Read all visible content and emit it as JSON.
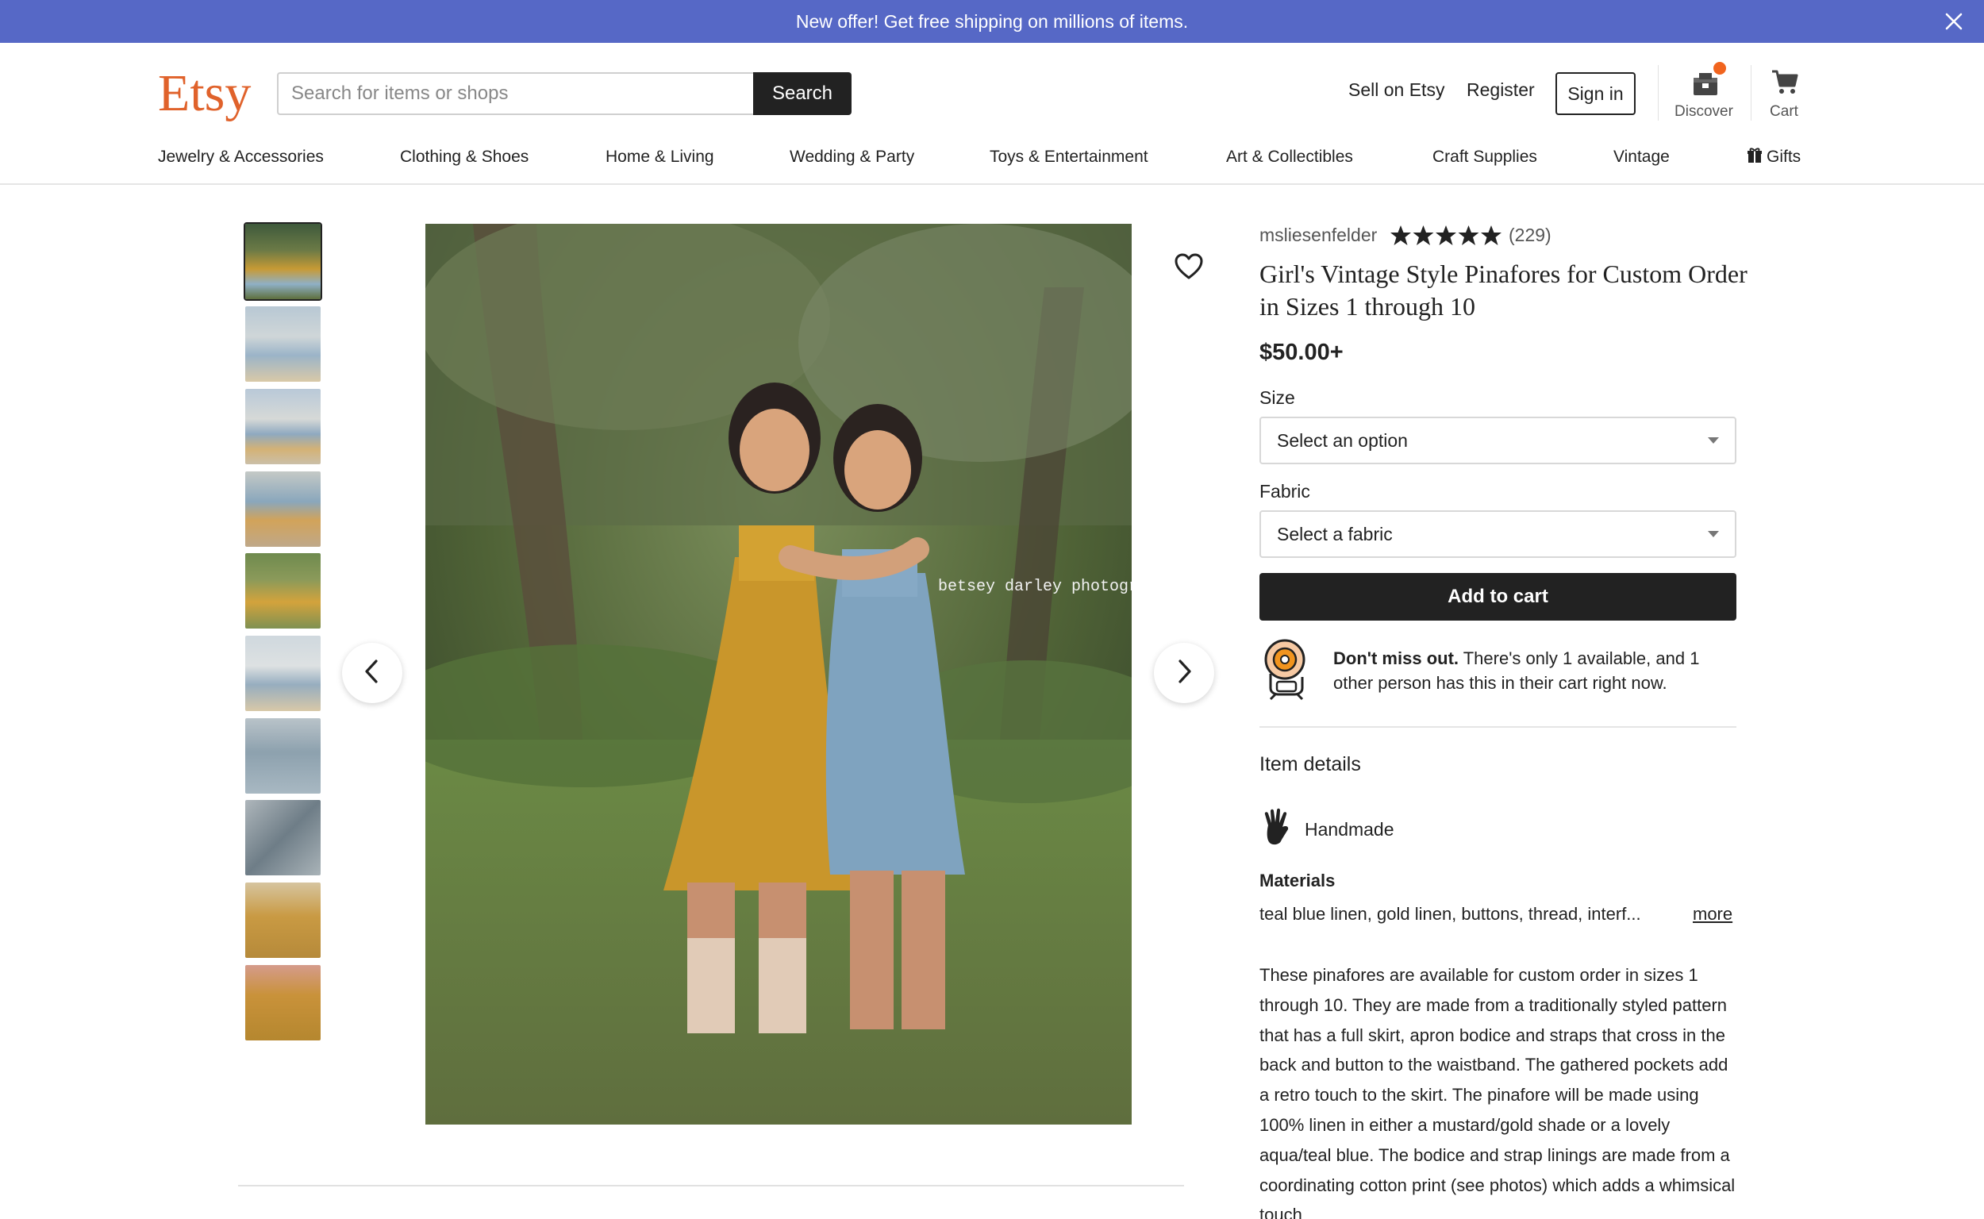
{
  "banner": {
    "text": "New offer! Get free shipping on millions of items.",
    "close_icon": "close-icon"
  },
  "header": {
    "logo": "Etsy",
    "search_placeholder": "Search for items or shops",
    "search_button": "Search",
    "sell_link": "Sell on Etsy",
    "register_link": "Register",
    "sign_in": "Sign in",
    "discover_label": "Discover",
    "cart_label": "Cart",
    "discover_icon": "discover-icon",
    "cart_icon": "cart-icon"
  },
  "categories": [
    "Jewelry & Accessories",
    "Clothing & Shoes",
    "Home & Living",
    "Wedding & Party",
    "Toys & Entertainment",
    "Art & Collectibles",
    "Craft Supplies",
    "Vintage",
    "Gifts"
  ],
  "gallery": {
    "thumbnail_count": 10,
    "active_index": 0,
    "watermark": "betsey darley photograh",
    "prev_icon": "chevron-left-icon",
    "next_icon": "chevron-right-icon",
    "favorite_icon": "heart-icon"
  },
  "product": {
    "shop_name": "msliesenfelder",
    "rating": 5,
    "review_count": "(229)",
    "title": "Girl's Vintage Style Pinafores for Custom Order in Sizes 1 through 10",
    "price": "$50.00+",
    "size_label": "Size",
    "size_value": "Select an option",
    "fabric_label": "Fabric",
    "fabric_value": "Select a fabric",
    "add_to_cart": "Add to cart",
    "alert_bold": "Don't miss out.",
    "alert_text": " There's only 1 available, and 1 other person has this in their cart right now.",
    "item_details_heading": "Item details",
    "handmade": "Handmade",
    "materials_heading": "Materials",
    "materials": "teal blue linen, gold linen, buttons, thread, interf...",
    "more_link": "more",
    "description": "These pinafores are available for custom order in sizes 1 through 10. They are made from a traditionally styled pattern that has a full skirt, apron bodice and straps that cross in the back and button to the waistband. The gathered pockets add a retro touch to the skirt. The pinafore will be made using 100% linen in either a mustard/gold shade or a lovely aqua/teal blue. The bodice and strap linings are made from a coordinating cotton print (see photos) which adds a whimsical touch"
  },
  "colors": {
    "banner_bg": "#5668c6",
    "brand_orange": "#e0622b",
    "button_dark": "#222222",
    "badge_orange": "#f1641e"
  }
}
